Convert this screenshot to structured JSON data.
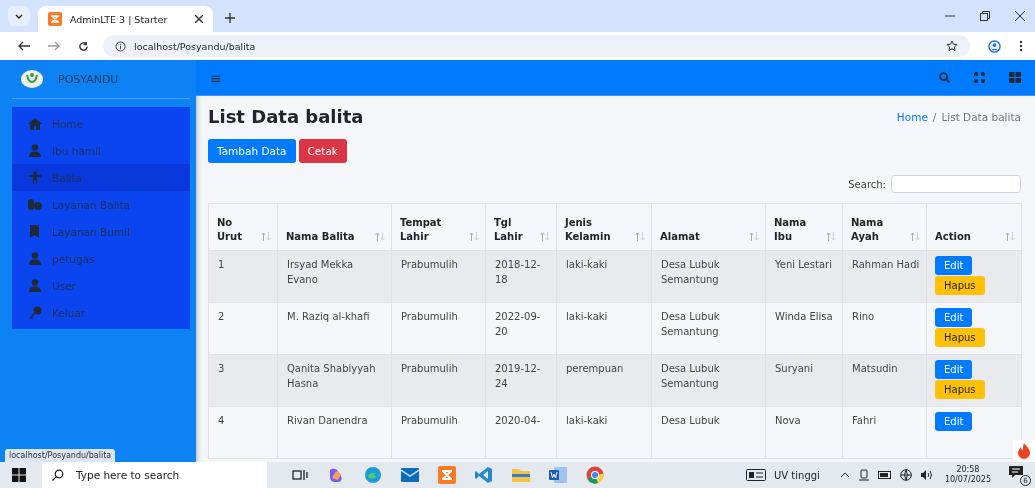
{
  "browser": {
    "tab_title": "AdminLTE 3 | Starter",
    "url": "localhost/Posyandu/balita"
  },
  "sidebar": {
    "brand": "POSYANDU",
    "items": [
      {
        "label": "Home",
        "selected": false
      },
      {
        "label": "Ibu hamil",
        "selected": false
      },
      {
        "label": "Balita",
        "selected": true
      },
      {
        "label": "Layanan Balita",
        "selected": false
      },
      {
        "label": "Layanan Bumil",
        "selected": false
      },
      {
        "label": "petugas",
        "selected": false
      },
      {
        "label": "User",
        "selected": false
      },
      {
        "label": "Keluar",
        "selected": false
      }
    ]
  },
  "navbar": {
    "menu_glyph": "≡"
  },
  "page": {
    "title": "List Data balita",
    "breadcrumb": [
      "Home",
      "List Data balita"
    ],
    "breadcrumb_separator": "/"
  },
  "buttons": [
    {
      "label": "Tambah Data",
      "kind": "primary"
    },
    {
      "label": "Cetak",
      "kind": "danger"
    }
  ],
  "search": {
    "label": "Search:"
  },
  "table": {
    "columns": [
      "No Urut",
      "Nama Balita",
      "Tempat Lahir",
      "Tgl Lahir",
      "Jenis Kelamin",
      "Alamat",
      "Nama Ibu",
      "Nama Ayah",
      "Action"
    ],
    "rows": [
      {
        "cells": [
          "1",
          "Irsyad Mekka Evano",
          "Prabumulih",
          "2018-12-18",
          "laki-kaki",
          "Desa Lubuk Semantung",
          "Yeni Lestari",
          "Rahman Hadi"
        ],
        "actions": [
          "Edit",
          "Hapus"
        ]
      },
      {
        "cells": [
          "2",
          "M. Raziq al-khafi",
          "Prabumulih",
          "2022-09-20",
          "laki-kaki",
          "Desa Lubuk Semantung",
          "Winda Elisa",
          "Rino"
        ],
        "actions": [
          "Edit",
          "Hapus"
        ]
      },
      {
        "cells": [
          "3",
          "Qanita Shabiyyah Hasna",
          "Prabumulih",
          "2019-12-24",
          "perempuan",
          "Desa Lubuk Semantung",
          "Suryani",
          "Matsudin"
        ],
        "actions": [
          "Edit",
          "Hapus"
        ]
      },
      {
        "cells": [
          "4",
          "Rivan Danendra",
          "Prabumulih",
          "2020-04-",
          "laki-kaki",
          "Desa Lubuk",
          "Nova",
          "Fahri"
        ],
        "actions": [
          "Edit"
        ]
      }
    ]
  },
  "status_url": "localhost/Posyandu/balita",
  "taskbar": {
    "search_placeholder": "Type here to search",
    "weather": "UV tinggi",
    "time": "20:58",
    "date": "10/07/2025",
    "notifications": "6"
  }
}
